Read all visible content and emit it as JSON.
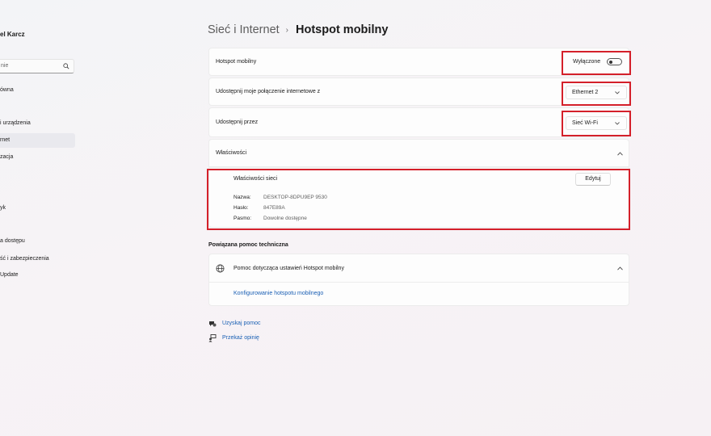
{
  "sidebar": {
    "user_name": "el Karcz",
    "search_placeholder": "nie",
    "items": [
      {
        "label": "ówna"
      },
      {
        "label": "i urządzenia"
      },
      {
        "label": "rnet"
      },
      {
        "label": "zacja"
      },
      {
        "label": "yk"
      },
      {
        "label": "a dostępu"
      },
      {
        "label": "ść i zabezpieczenia"
      },
      {
        "label": "Update"
      }
    ]
  },
  "header": {
    "parent": "Sieć i Internet",
    "current": "Hotspot mobilny"
  },
  "hotspot": {
    "label": "Hotspot mobilny",
    "toggle_state": "Wyłączone",
    "toggle_on": false
  },
  "share_from": {
    "label": "Udostępnij moje połączenie internetowe z",
    "value": "Ethernet 2"
  },
  "share_over": {
    "label": "Udostępnij przez",
    "value": "Sieć Wi-Fi"
  },
  "properties": {
    "label": "Właściwości",
    "network_title": "Właściwości sieci",
    "edit_label": "Edytuj",
    "rows": [
      {
        "key": "Nazwa:",
        "value": "DESKTOP-8DPU9EP 9530"
      },
      {
        "key": "Hasło:",
        "value": "847E89A"
      },
      {
        "key": "Pasmo:",
        "value": "Dowolne dostępne"
      }
    ]
  },
  "related": {
    "title": "Powiązana pomoc techniczna",
    "help_label": "Pomoc dotycząca ustawień Hotspot mobilny",
    "link_label": "Konfigurowanie hotspotu mobilnego"
  },
  "footer": {
    "get_help": "Uzyskaj pomoc",
    "feedback": "Przekaż opinię"
  },
  "colors": {
    "highlight": "#d4202a",
    "link": "#1a5fb4"
  }
}
